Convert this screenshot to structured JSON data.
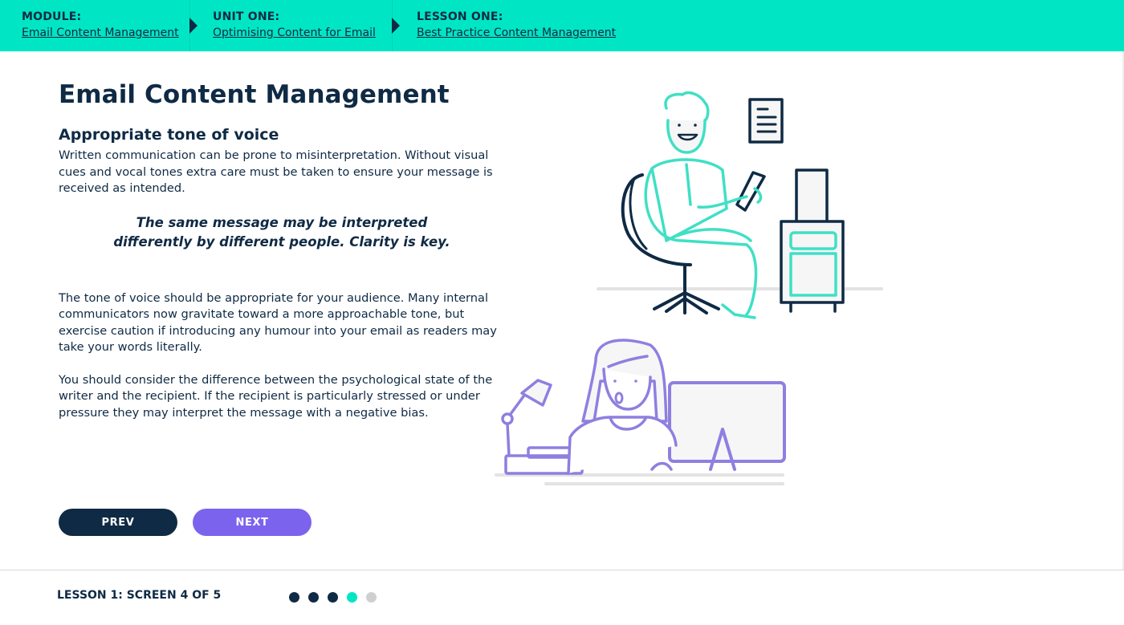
{
  "breadcrumb": {
    "module": {
      "label": "MODULE:",
      "link": "Email Content Management"
    },
    "unit": {
      "label": "UNIT ONE:",
      "link": "Optimising Content for Email"
    },
    "lesson": {
      "label": "LESSON ONE:",
      "link": "Best Practice Content Management"
    }
  },
  "page": {
    "title": "Email Content Management",
    "subtitle": "Appropriate tone of voice",
    "paragraph1": "Written communication can be prone to misinterpretation. Without visual cues and vocal tones extra care must be taken to ensure your message is received as intended.",
    "quote_line1": "The same message may be interpreted",
    "quote_line2": "differently by different people. Clarity is key.",
    "paragraph2": "The tone of voice should be appropriate for your audience. Many internal communicators now gravitate toward a more approachable tone, but exercise caution if introducing any humour into your email as readers may take your words literally.",
    "paragraph3": "You should consider the difference between the psychological state of the writer and the recipient. If the recipient is particularly stressed or under pressure they may interpret the message with a negative bias."
  },
  "nav": {
    "prev_label": "PREV",
    "next_label": "NEXT"
  },
  "footer": {
    "progress_text": "LESSON 1: SCREEN 4 OF 5",
    "current_screen": 4,
    "total_screens": 5
  },
  "colors": {
    "header_bg": "#00e6c4",
    "navy": "#0f2a44",
    "purple": "#7c63ee",
    "teal": "#3fe0c5",
    "lavender": "#8f7fe0"
  },
  "illustrations": [
    "man-in-chair-with-phone-illustration",
    "woman-at-desk-illustration"
  ]
}
